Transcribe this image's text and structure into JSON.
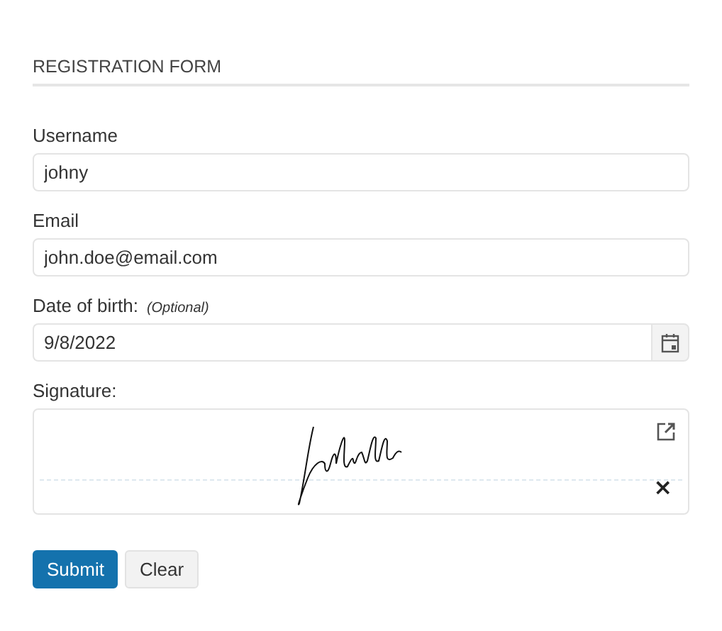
{
  "form": {
    "title": "REGISTRATION FORM",
    "fields": [
      {
        "kind": "text",
        "label": "Username",
        "value": "johny"
      },
      {
        "kind": "text",
        "label": "Email",
        "value": "john.doe@email.com"
      },
      {
        "kind": "date",
        "label": "Date of birth:",
        "note": "(Optional)",
        "value": "9/8/2022"
      },
      {
        "kind": "signature",
        "label": "Signature:",
        "clear": "×"
      }
    ],
    "buttons": [
      {
        "label": "Submit",
        "kind": "primary"
      },
      {
        "label": "Clear",
        "kind": "secondary"
      }
    ]
  }
}
